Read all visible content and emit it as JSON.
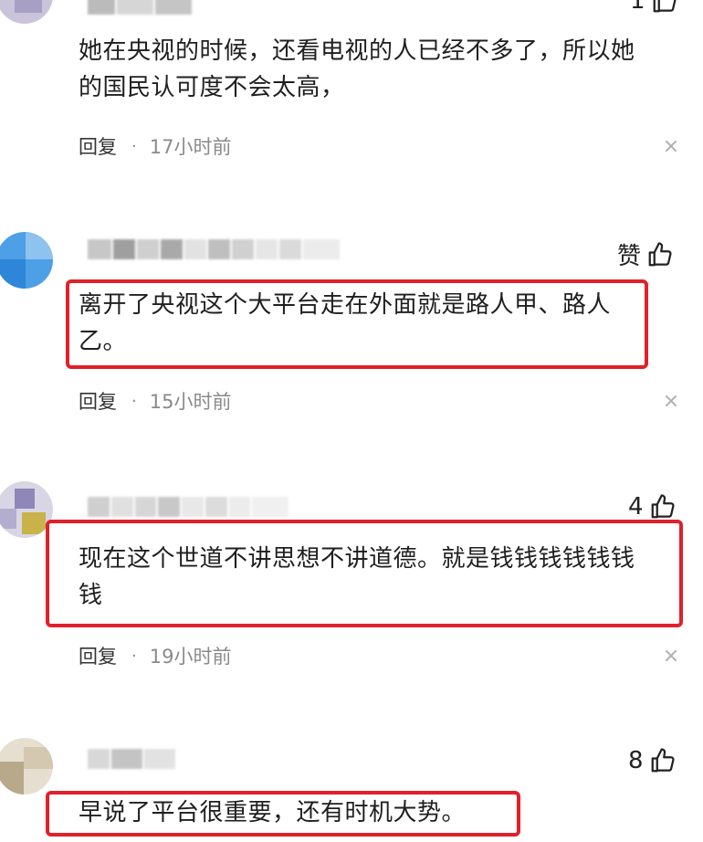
{
  "comments": [
    {
      "text_line1": "她在央视的时候，还看电视的人已经不多了，所以她",
      "text_line2": "的国民认可度不会太高，",
      "reply_label": "回复",
      "separator": "·",
      "time": "17小时前",
      "like_count": "1"
    },
    {
      "text_line1": "离开了央视这个大平台走在外面就是路人甲、路人",
      "text_line2": "乙。",
      "reply_label": "回复",
      "separator": "·",
      "time": "15小时前",
      "like_label": "赞"
    },
    {
      "text_line1": "现在这个世道不讲思想不讲道德。就是钱钱钱钱钱钱",
      "text_line2": "钱",
      "reply_label": "回复",
      "separator": "·",
      "time": "19小时前",
      "like_count": "4"
    },
    {
      "text_line1": "早说了平台很重要，还有时机大势。",
      "like_count": "8"
    }
  ],
  "colors": {
    "highlight_border": "#e0202a",
    "text": "#1f1f1f",
    "meta_text": "#8a8a8a"
  },
  "icons": {
    "like": "thumbs-up-icon",
    "close": "close-icon"
  }
}
